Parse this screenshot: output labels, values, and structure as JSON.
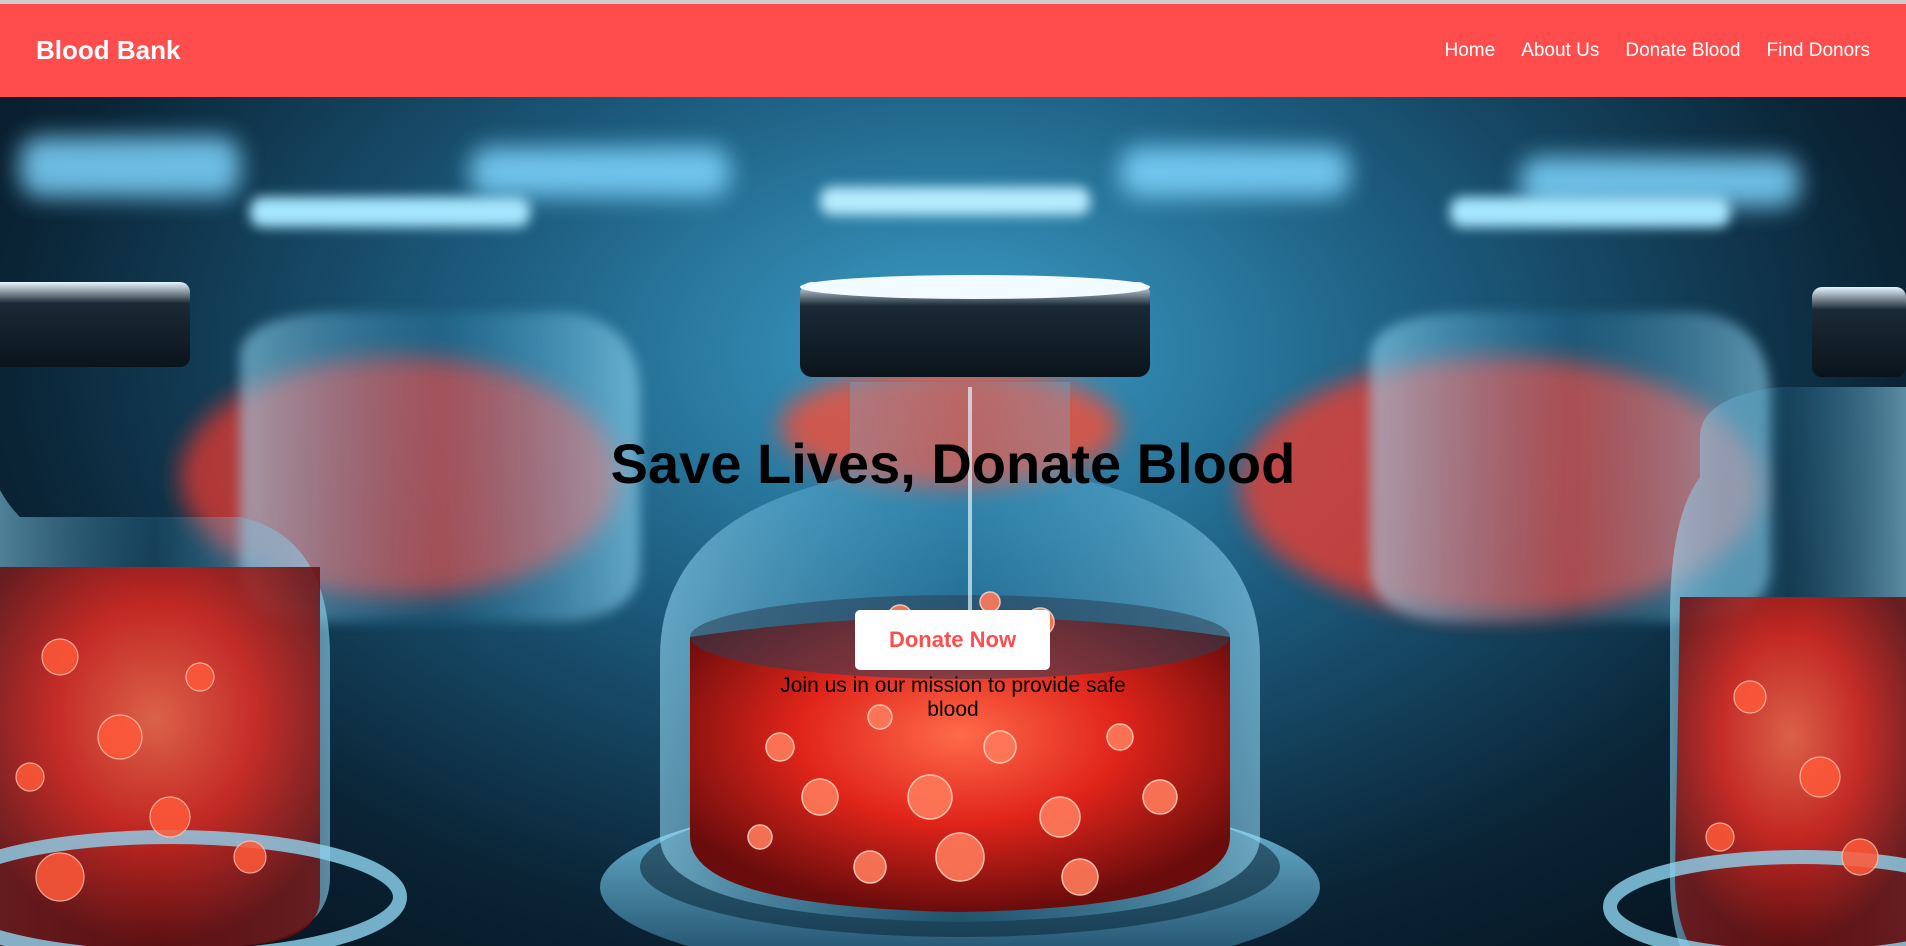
{
  "navbar": {
    "brand": "Blood Bank",
    "links": [
      "Home",
      "About Us",
      "Donate Blood",
      "Find Donors"
    ]
  },
  "hero": {
    "title": "Save Lives, Donate Blood",
    "subtitle": "Join us in our mission to provide safe blood",
    "cta_label": "Donate Now",
    "background_image": "blood-sample-vials-photo"
  },
  "colors": {
    "accent": "#ff4d4d",
    "button_bg": "#ffffff",
    "text_dark": "#000000"
  }
}
